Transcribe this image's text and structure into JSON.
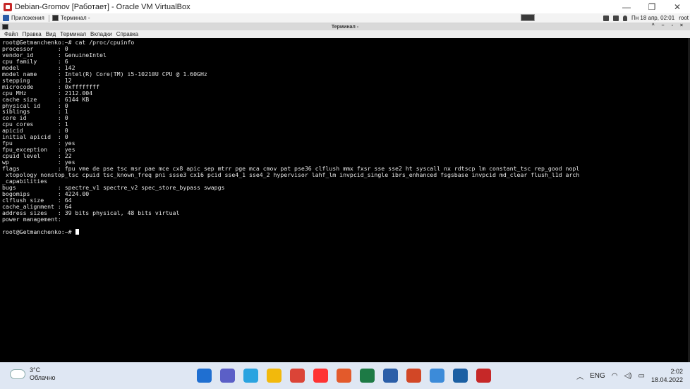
{
  "window": {
    "title": "Debian-Gromov [Работает] - Oracle VM VirtualBox",
    "controls": [
      "—",
      "❐",
      "✕"
    ]
  },
  "guest_panel": {
    "apps_label": "Приложения",
    "terminal_label": "Терминал -",
    "datetime": "Пн 18 апр, 02:01",
    "user": "root"
  },
  "terminal": {
    "title": "Терминал -",
    "menu": [
      "Файл",
      "Правка",
      "Вид",
      "Терминал",
      "Вкладки",
      "Справка"
    ],
    "output": "root@Getmanchenko:~# cat /proc/cpuinfo\nprocessor       : 0\nvendor_id       : GenuineIntel\ncpu family      : 6\nmodel           : 142\nmodel name      : Intel(R) Core(TM) i5-10210U CPU @ 1.60GHz\nstepping        : 12\nmicrocode       : 0xffffffff\ncpu MHz         : 2112.004\ncache size      : 6144 KB\nphysical id     : 0\nsiblings        : 1\ncore id         : 0\ncpu cores       : 1\napicid          : 0\ninitial apicid  : 0\nfpu             : yes\nfpu_exception   : yes\ncpuid level     : 22\nwp              : yes\nflags           : fpu vme de pse tsc msr pae mce cx8 apic sep mtrr pge mca cmov pat pse36 clflush mmx fxsr sse sse2 ht syscall nx rdtscp lm constant_tsc rep_good nopl\n xtopology nonstop_tsc cpuid tsc_known_freq pni ssse3 cx16 pcid sse4_1 sse4_2 hypervisor lahf_lm invpcid_single ibrs_enhanced fsgsbase invpcid md_clear flush_l1d arch\n_capabilities\nbugs            : spectre_v1 spectre_v2 spec_store_bypass swapgs\nbogomips        : 4224.00\nclflush size    : 64\ncache_alignment : 64\naddress sizes   : 39 bits physical, 48 bits virtual\npower management:\n\n",
    "prompt": "root@Getmanchenko:~# "
  },
  "taskbar": {
    "temperature": "3°C",
    "weather": "Облачно",
    "language": "ENG",
    "time": "2:02",
    "date": "18.04.2022",
    "apps": [
      {
        "name": "start-icon",
        "color": "#1f6fd1"
      },
      {
        "name": "teams-chat-icon",
        "color": "#5b5fc7"
      },
      {
        "name": "telegram-icon",
        "color": "#2aa3e0"
      },
      {
        "name": "file-explorer-icon",
        "color": "#f2b90c"
      },
      {
        "name": "chrome-icon",
        "color": "#db4437"
      },
      {
        "name": "yandex-browser-icon",
        "color": "#ff3333"
      },
      {
        "name": "office-icon",
        "color": "#e35a2b"
      },
      {
        "name": "excel-icon",
        "color": "#1d7a45"
      },
      {
        "name": "word-icon",
        "color": "#2b5ea8"
      },
      {
        "name": "powerpoint-icon",
        "color": "#d24726"
      },
      {
        "name": "notepad-icon",
        "color": "#3c8bd9"
      },
      {
        "name": "virtualbox-icon",
        "color": "#1b5fa3"
      },
      {
        "name": "debian-vm-icon",
        "color": "#c62828"
      }
    ]
  }
}
